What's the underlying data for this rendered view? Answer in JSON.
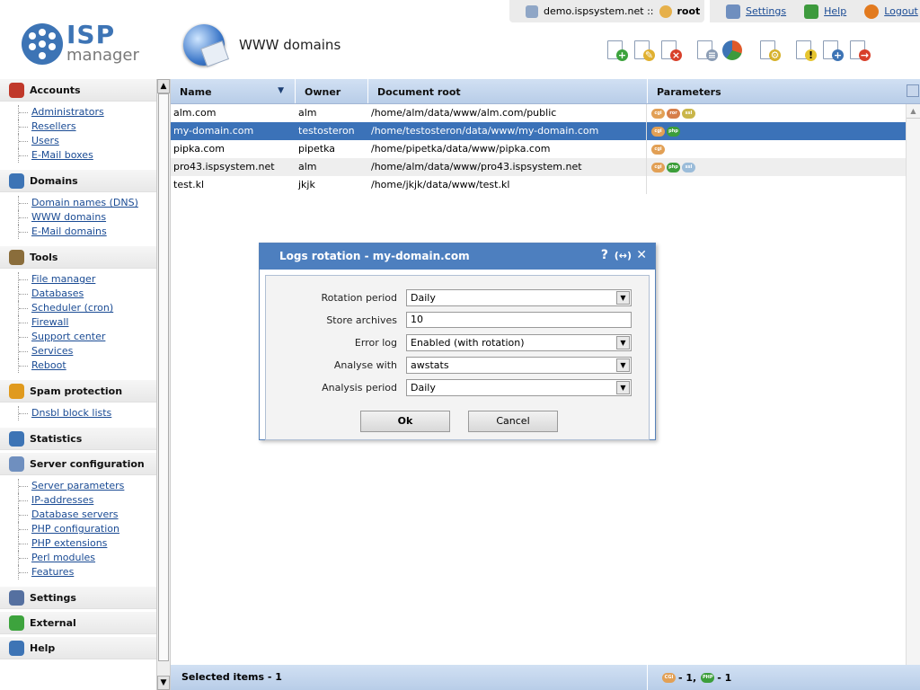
{
  "header": {
    "logo_top": "ISP",
    "logo_bottom": "manager",
    "page_title": "WWW domains",
    "server": "demo.ispsystem.net ::",
    "user": "root",
    "links": {
      "settings": "Settings",
      "help": "Help",
      "logout": "Logout"
    }
  },
  "sidebar": {
    "sections": [
      {
        "title": "Accounts",
        "items": [
          "Administrators",
          "Resellers",
          "Users",
          "E-Mail boxes"
        ]
      },
      {
        "title": "Domains",
        "items": [
          "Domain names (DNS)",
          "WWW domains",
          "E-Mail domains"
        ]
      },
      {
        "title": "Tools",
        "items": [
          "File manager",
          "Databases",
          "Scheduler (cron)",
          "Firewall",
          "Support center",
          "Services",
          "Reboot"
        ]
      },
      {
        "title": "Spam protection",
        "items": [
          "Dnsbl block lists"
        ]
      },
      {
        "title": "Statistics",
        "items": []
      },
      {
        "title": "Server configuration",
        "items": [
          "Server parameters",
          "IP-addresses",
          "Database servers",
          "PHP configuration",
          "PHP extensions",
          "Perl modules",
          "Features"
        ]
      },
      {
        "title": "Settings",
        "items": []
      },
      {
        "title": "External",
        "items": []
      },
      {
        "title": "Help",
        "items": []
      }
    ]
  },
  "table": {
    "columns": [
      "Name",
      "Owner",
      "Document root",
      "Parameters"
    ],
    "rows": [
      {
        "name": "alm.com",
        "owner": "alm",
        "root": "/home/alm/data/www/alm.com/public",
        "params": [
          "cgi",
          "ror",
          "ssl"
        ]
      },
      {
        "name": "my-domain.com",
        "owner": "testosteron",
        "root": "/home/testosteron/data/www/my-domain.com",
        "params": [
          "cgi",
          "php"
        ]
      },
      {
        "name": "pipka.com",
        "owner": "pipetka",
        "root": "/home/pipetka/data/www/pipka.com",
        "params": [
          "cgi"
        ]
      },
      {
        "name": "pro43.ispsystem.net",
        "owner": "alm",
        "root": "/home/alm/data/www/pro43.ispsystem.net",
        "params": [
          "cgi",
          "php",
          "ssl"
        ]
      },
      {
        "name": "test.kl",
        "owner": "jkjk",
        "root": "/home/jkjk/data/www/test.kl",
        "params": []
      }
    ],
    "selected_index": 1
  },
  "footer": {
    "selected": "Selected items - 1",
    "count_cgi": "- 1,",
    "count_php": "- 1"
  },
  "dialog": {
    "title": "Logs rotation - my-domain.com",
    "fields": [
      {
        "label": "Rotation period",
        "type": "select",
        "value": "Daily"
      },
      {
        "label": "Store archives",
        "type": "input",
        "value": "10"
      },
      {
        "label": "Error log",
        "type": "select",
        "value": "Enabled (with rotation)"
      },
      {
        "label": "Analyse with",
        "type": "select",
        "value": "awstats"
      },
      {
        "label": "Analysis period",
        "type": "select",
        "value": "Daily"
      }
    ],
    "ok_label": "Ok",
    "cancel_label": "Cancel",
    "help_glyph": "?",
    "expand_glyph": "(↔)",
    "close_glyph": "✕"
  },
  "colors": {
    "accent": "#4d7fbf",
    "selected_row": "#3b72b8",
    "header": "#c4d6ee"
  }
}
